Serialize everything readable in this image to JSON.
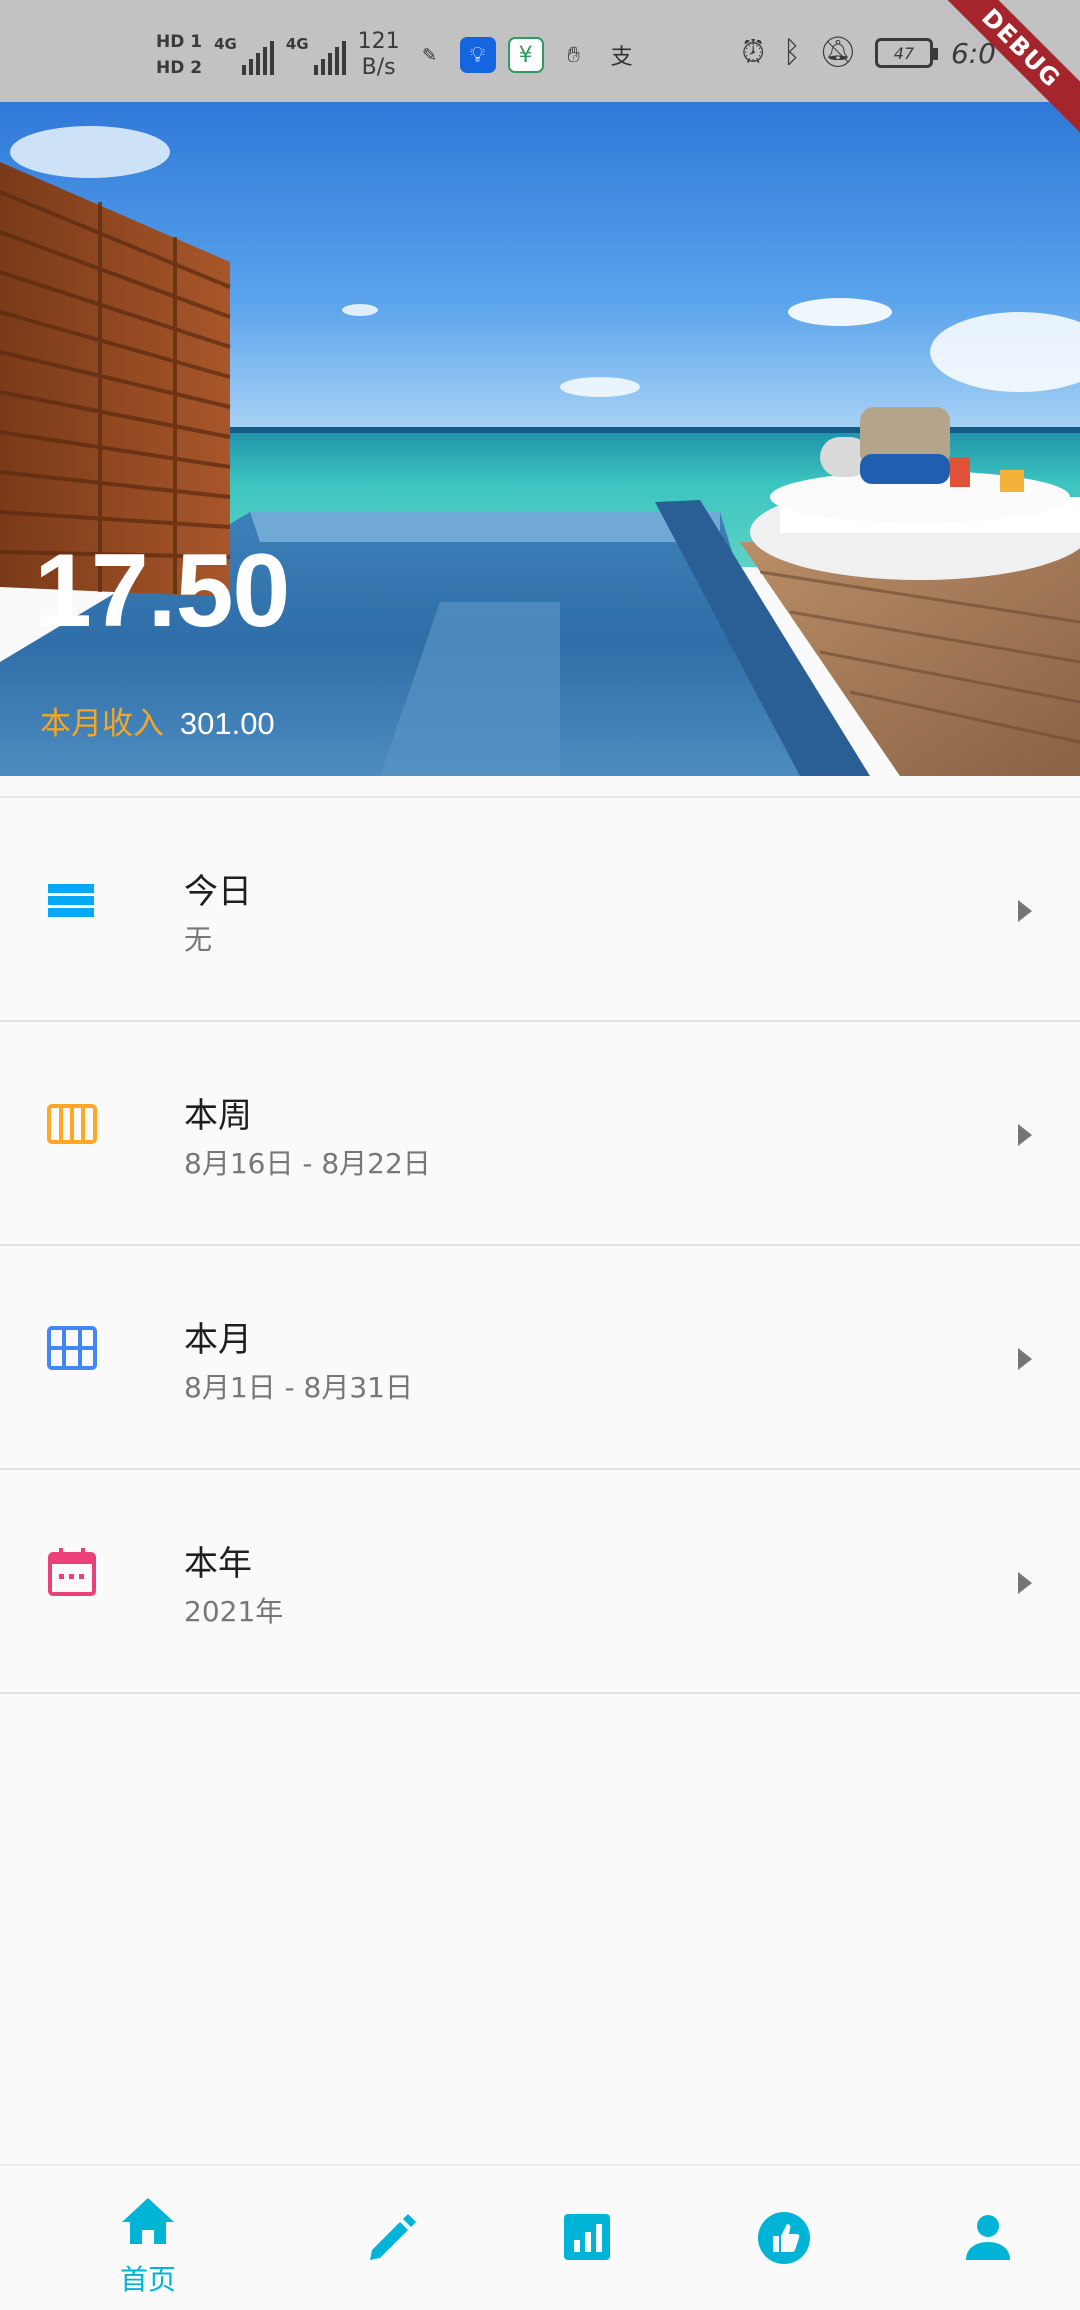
{
  "status_bar": {
    "hd1": "HD 1",
    "hd2": "HD 2",
    "sig1_label": "4G",
    "sig2_label": "4G",
    "net_speed_value": "121",
    "net_speed_unit": "B/s",
    "apps": [
      "app-icon-xuexi",
      "app-icon-bulb",
      "app-icon-wallet",
      "app-icon-hand",
      "app-icon-alipay"
    ],
    "alipay_char": "支",
    "battery_level": "47",
    "clock": "6:0"
  },
  "debug_banner": "DEBUG",
  "hero": {
    "amount": "17.50",
    "month_income_label": "本月收入",
    "month_income_value": "301.00"
  },
  "list": [
    {
      "title": "今日",
      "subtitle": "无",
      "icon": "today-icon",
      "color": "#03a9f4"
    },
    {
      "title": "本周",
      "subtitle": "8月16日 - 8月22日",
      "icon": "week-icon",
      "color": "#ffa726"
    },
    {
      "title": "本月",
      "subtitle": "8月1日 - 8月31日",
      "icon": "month-icon",
      "color": "#4287f5"
    },
    {
      "title": "本年",
      "subtitle": "2021年",
      "icon": "year-icon",
      "color": "#ec407a"
    }
  ],
  "bottom_nav": {
    "accent": "#00b4d8",
    "items": [
      {
        "name": "home",
        "label": "首页",
        "active": true
      },
      {
        "name": "edit",
        "label": "",
        "active": false
      },
      {
        "name": "stats",
        "label": "",
        "active": false
      },
      {
        "name": "like",
        "label": "",
        "active": false
      },
      {
        "name": "profile",
        "label": "",
        "active": false
      }
    ]
  }
}
